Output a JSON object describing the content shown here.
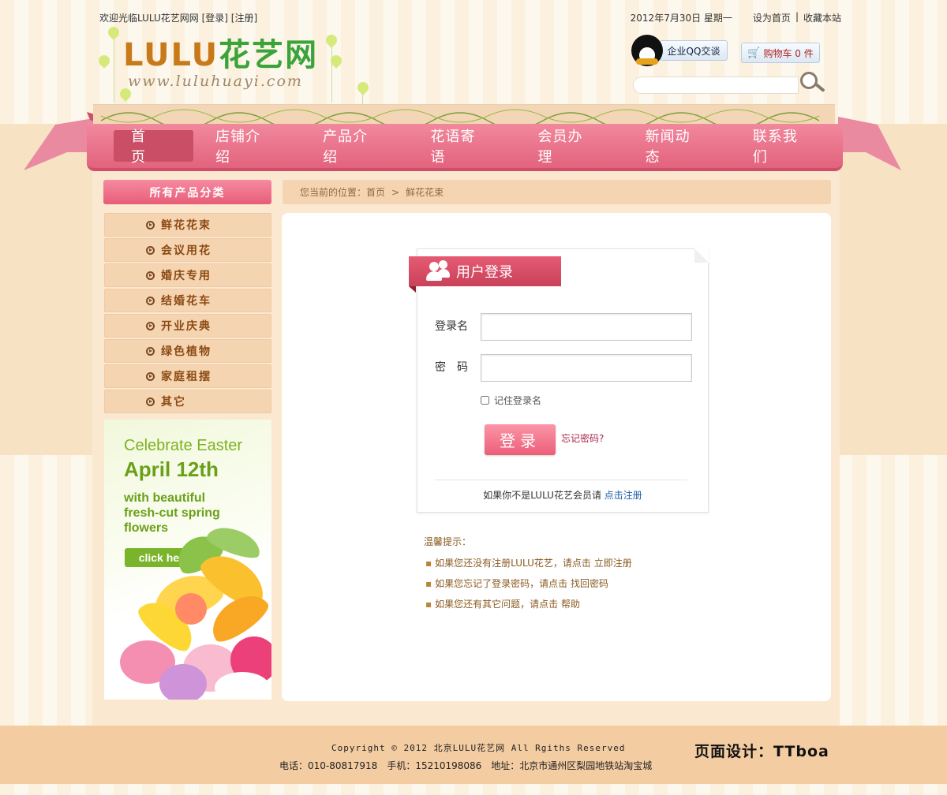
{
  "topbar": {
    "welcome": "欢迎光临LULU花艺网网",
    "login_link": "[登录]",
    "register_link": "[注册]",
    "date": "2012年7月30日 星期一",
    "set_home": "设为首页",
    "separator": "|",
    "bookmark": "收藏本站"
  },
  "logo": {
    "latin": "LULU",
    "chinese": "花艺网",
    "url": "www.luluhuayi.com"
  },
  "header": {
    "qq_label": "企业QQ交谈",
    "cart_label": "购物车 0 件",
    "search_placeholder": ""
  },
  "nav": {
    "items": [
      {
        "label": "首页"
      },
      {
        "label": "店铺介绍"
      },
      {
        "label": "产品介绍"
      },
      {
        "label": "花语寄语"
      },
      {
        "label": "会员办理"
      },
      {
        "label": "新闻动态"
      },
      {
        "label": "联系我们"
      }
    ]
  },
  "sidebar": {
    "title": "所有产品分类",
    "items": [
      {
        "label": "鲜花花束"
      },
      {
        "label": "会议用花"
      },
      {
        "label": "婚庆专用"
      },
      {
        "label": "结婚花车"
      },
      {
        "label": "开业庆典"
      },
      {
        "label": "绿色植物"
      },
      {
        "label": "家庭租摆"
      },
      {
        "label": "其它"
      }
    ],
    "banner": {
      "line1": "Celebrate Easter",
      "line2": "April 12th",
      "line3": "with beautiful fresh-cut spring flowers",
      "button": "click here"
    }
  },
  "breadcrumb": {
    "prefix": "您当前的位置：",
    "home": "首页",
    "arrow": ">",
    "current": "鲜花花束"
  },
  "login": {
    "title": "用户登录",
    "username_label": "登录名",
    "username_value": "",
    "password_label": "密　码",
    "password_value": "",
    "remember_label": "记住登录名",
    "submit_label": "登录",
    "forgot_label": "忘记密码?",
    "footer_text": "如果你不是LULU花艺会员请",
    "footer_link": "点击注册"
  },
  "tips": {
    "title": "温馨提示：",
    "items": [
      {
        "text": "如果您还没有注册LULU花艺，请点击",
        "action": "立即注册"
      },
      {
        "text": "如果您忘记了登录密码，请点击",
        "action": "找回密码"
      },
      {
        "text": "如果您还有其它问题，请点击",
        "action": "帮助"
      }
    ]
  },
  "footer": {
    "copyright": "Copyright © 2012 北京LULU花艺网 All Rgiths Reserved",
    "contact": "电话：010-80817918　手机：15210198086　地址：北京市通州区梨园地铁站淘宝城",
    "designer": "页面设计：TTboa"
  },
  "colors": {
    "nav_pink": "#e3637d",
    "sidebar_tan": "#f5d4b2",
    "logo_orange": "#c87a1a",
    "logo_green": "#3aa33a",
    "footer_tan": "#f3cca2"
  }
}
